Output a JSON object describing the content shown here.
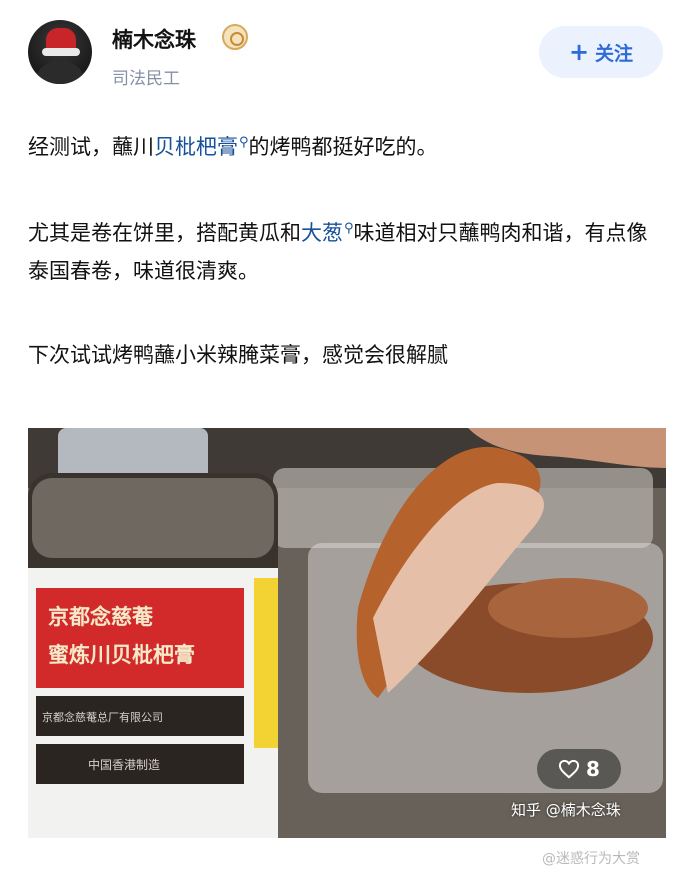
{
  "header": {
    "username": "楠木念珠",
    "subtitle": "司法民工",
    "follow_label": "关注",
    "follow_icon": "plus-icon",
    "badge_icon": "verified-badge-icon"
  },
  "post": {
    "p1_pre": "经测试，蘸川",
    "p1_link": "贝枇杷膏",
    "p1_post": "的烤鸭都挺好吃的。",
    "p2_pre": "尤其是卷在饼里，搭配黄瓜和",
    "p2_link": "大葱",
    "p2_post": "味道相对只蘸鸭肉和谐，有点像泰国春卷，味道很清爽。",
    "p3": "下次试试烤鸭蘸小米辣腌菜膏，感觉会很解腻"
  },
  "photo": {
    "label_line1": "京都念慈菴",
    "label_line2": "蜜炼川贝枇杷膏",
    "label_line3": "京都念慈菴总厂有限公司",
    "label_line4": "中国香港制造",
    "likes_count": "8",
    "likes_icon": "heart-icon",
    "watermark": "知乎 @楠木念珠"
  },
  "footer": {
    "weibo_mark": "@迷惑行为大赏"
  },
  "colors": {
    "accent": "#2f6bd8",
    "link": "#175199",
    "muted": "#8590a6"
  }
}
